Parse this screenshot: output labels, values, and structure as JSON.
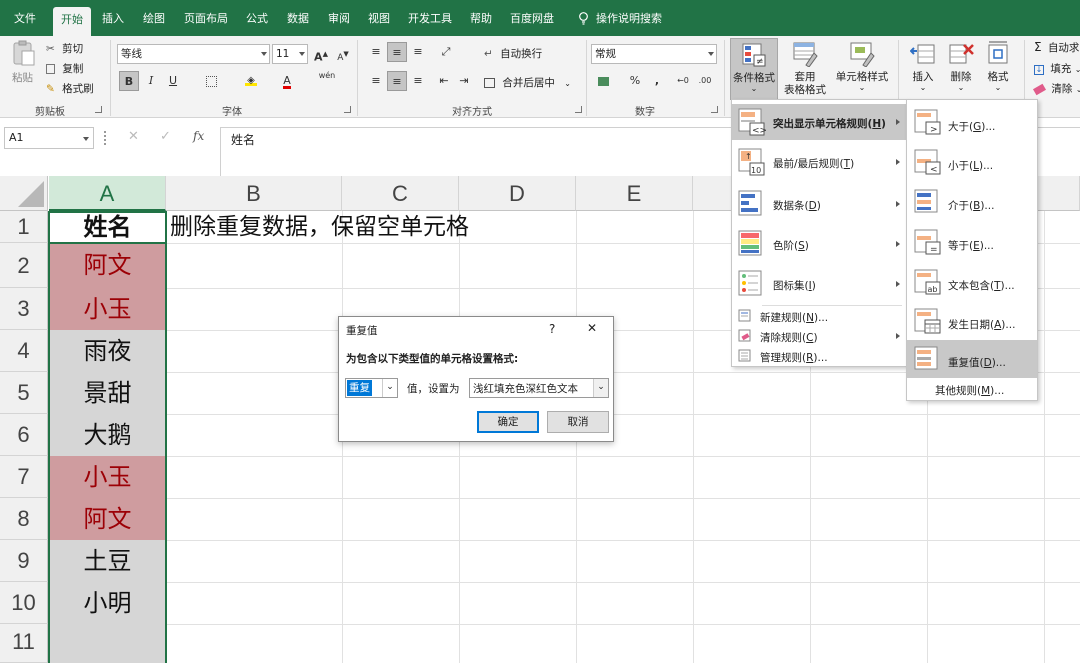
{
  "tabs": [
    "文件",
    "开始",
    "插入",
    "绘图",
    "页面布局",
    "公式",
    "数据",
    "审阅",
    "视图",
    "开发工具",
    "帮助",
    "百度网盘"
  ],
  "active_tab": "开始",
  "tell_me": "操作说明搜索",
  "ribbon": {
    "clipboard": {
      "paste": "粘贴",
      "cut": "剪切",
      "copy": "复制",
      "format_painter": "格式刷",
      "label": "剪贴板"
    },
    "font": {
      "name": "等线",
      "size": "11",
      "bold": "B",
      "italic": "I",
      "underline": "U",
      "grow": "A",
      "shrink": "A",
      "font_color_glyph": "A",
      "phonetic": "wén",
      "label": "字体"
    },
    "alignment": {
      "wrap": "自动换行",
      "merge": "合并后居中",
      "label": "对齐方式"
    },
    "number": {
      "format": "常规",
      "percent": "%",
      "comma": ",",
      "label": "数字"
    },
    "styles": {
      "conditional": "条件格式",
      "table_line1": "套用",
      "table_line2": "表格格式",
      "cell_styles": "单元格样式"
    },
    "cells": {
      "insert": "插入",
      "delete": "删除",
      "format": "格式"
    },
    "editing": {
      "autosum": "自动求",
      "fill": "填充",
      "clear": "清除"
    }
  },
  "formula_bar": {
    "name_box": "A1",
    "fx": "fx",
    "content": "姓名"
  },
  "columns": [
    "A",
    "B",
    "C",
    "D",
    "E"
  ],
  "selected_column": "A",
  "rows": [
    "1",
    "2",
    "3",
    "4",
    "5",
    "6",
    "7",
    "8",
    "9",
    "10",
    "11"
  ],
  "cells": {
    "A": [
      "姓名",
      "阿文",
      "小玉",
      "雨夜",
      "景甜",
      "大鹅",
      "小玉",
      "阿文",
      "土豆",
      "小明",
      ""
    ],
    "B1": "删除重复数据，保留空单元格"
  },
  "duplicate_rows": [
    2,
    3,
    7,
    8
  ],
  "dialog": {
    "title": "重复值",
    "help": "?",
    "close": "✕",
    "instruction": "为包含以下类型值的单元格设置格式:",
    "type_value": "重复",
    "mid_label": "值，设置为",
    "format_value": "浅红填充色深红色文本",
    "ok": "确定",
    "cancel": "取消"
  },
  "menu_cf": {
    "items": [
      {
        "label": "突出显示单元格规则",
        "key": "H",
        "submenu": true,
        "highlighted": true
      },
      {
        "label": "最前/最后规则",
        "key": "T",
        "submenu": true
      },
      {
        "label": "数据条",
        "key": "D",
        "submenu": true
      },
      {
        "label": "色阶",
        "key": "S",
        "submenu": true
      },
      {
        "label": "图标集",
        "key": "I",
        "submenu": true
      }
    ],
    "small_items": [
      {
        "label": "新建规则",
        "key": "N",
        "suffix": "..."
      },
      {
        "label": "清除规则",
        "key": "C",
        "submenu": true
      },
      {
        "label": "管理规则",
        "key": "R",
        "suffix": "..."
      }
    ]
  },
  "menu_highlight": {
    "items": [
      {
        "label": "大于",
        "key": "G",
        "icon_glyph": ">"
      },
      {
        "label": "小于",
        "key": "L",
        "icon_glyph": "<"
      },
      {
        "label": "介于",
        "key": "B",
        "icon_glyph": ""
      },
      {
        "label": "等于",
        "key": "E",
        "icon_glyph": "="
      },
      {
        "label": "文本包含",
        "key": "T",
        "icon_glyph": "ab"
      },
      {
        "label": "发生日期",
        "key": "A",
        "icon_glyph": ""
      },
      {
        "label": "重复值",
        "key": "D",
        "icon_glyph": "",
        "highlighted": true
      }
    ],
    "more": {
      "label": "其他规则",
      "key": "M"
    }
  },
  "colors": {
    "accent": "#217346",
    "dup_fill": "#cf9c9f",
    "dup_text": "#9c0006"
  }
}
